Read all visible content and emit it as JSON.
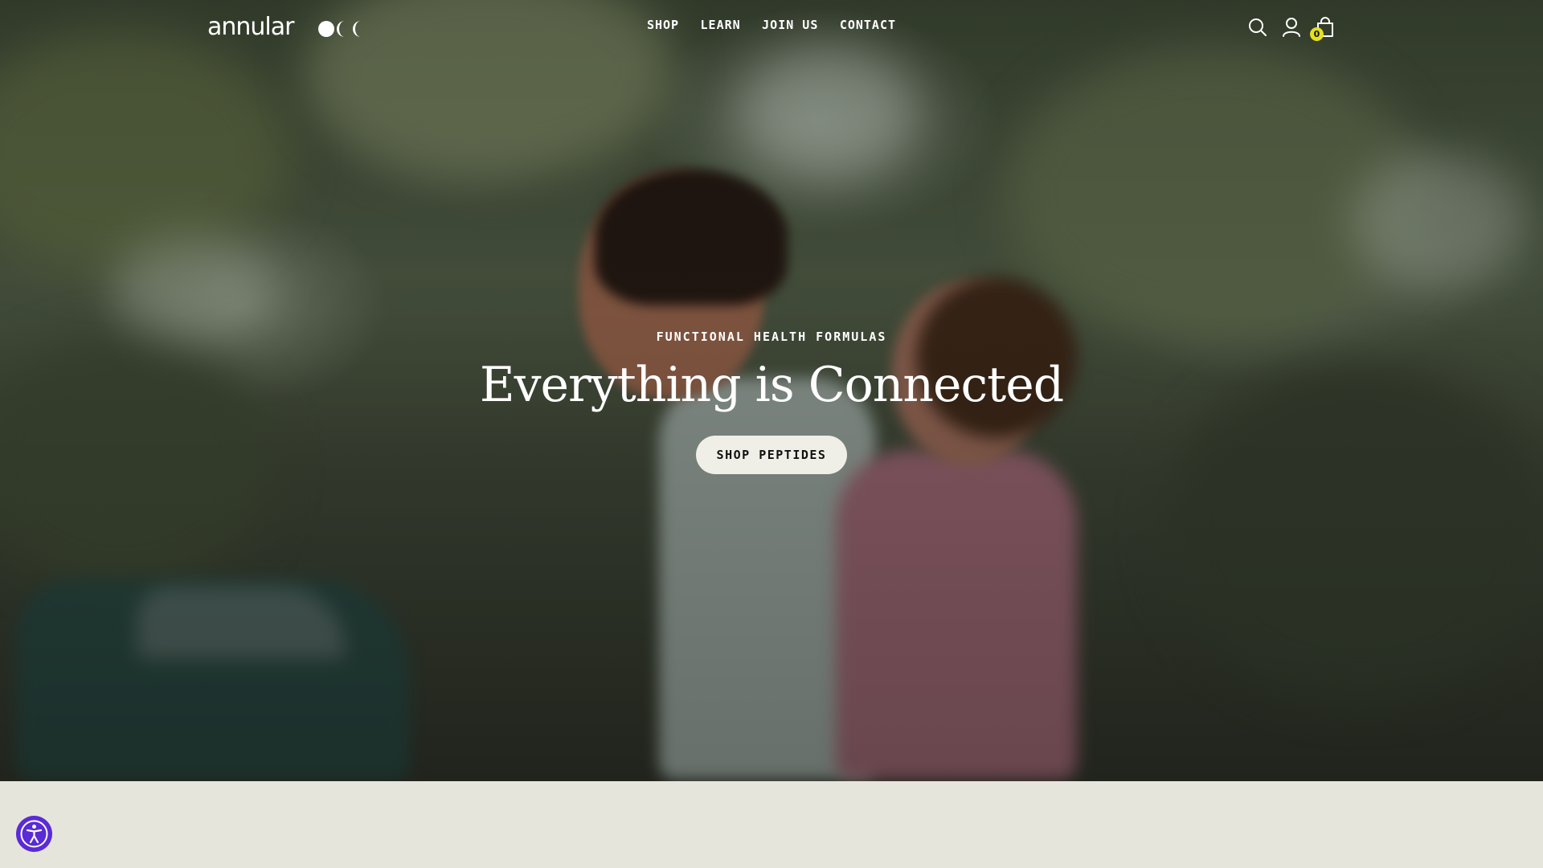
{
  "brand": {
    "logo_text": "annular",
    "logo_mark_icon": "moon-phases-icon"
  },
  "nav": {
    "items": [
      {
        "label": "SHOP"
      },
      {
        "label": "LEARN"
      },
      {
        "label": "JOIN US"
      },
      {
        "label": "CONTACT"
      }
    ]
  },
  "header_icons": {
    "search": "search-icon",
    "account": "user-icon",
    "cart": "bag-icon",
    "cart_count": "0",
    "badge_color": "#e6e01e"
  },
  "hero": {
    "eyebrow": "FUNCTIONAL HEALTH FORMULAS",
    "headline": "Everything is Connected",
    "cta_label": "SHOP PEPTIDES"
  },
  "accessibility": {
    "icon": "accessibility-icon",
    "color": "#5a2bd6"
  }
}
